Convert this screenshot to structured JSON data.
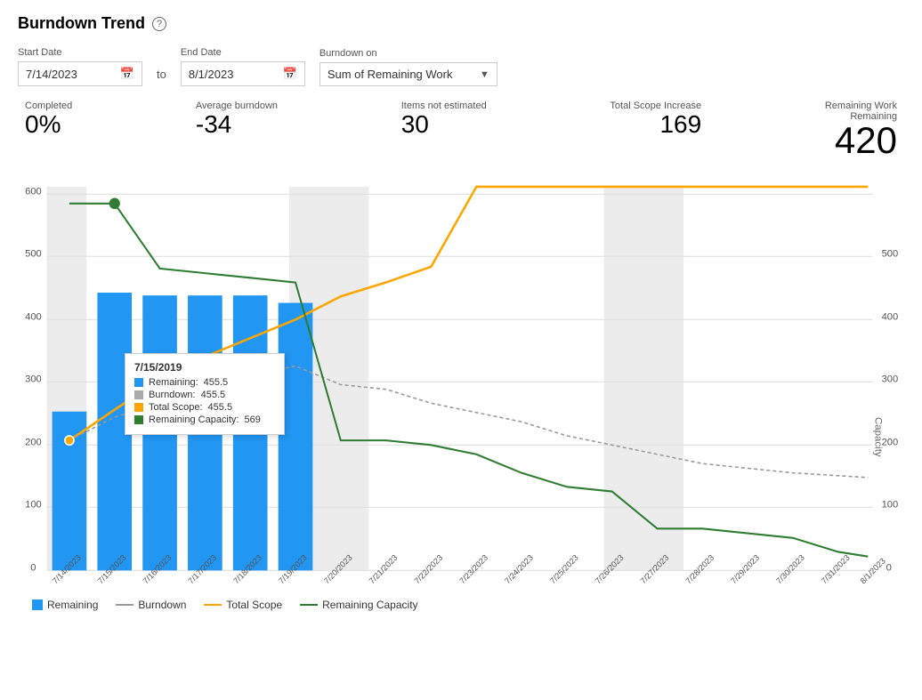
{
  "title": "Burndown Trend",
  "help_icon": "?",
  "controls": {
    "start_date_label": "Start Date",
    "start_date_value": "7/14/2023",
    "to_label": "to",
    "end_date_label": "End Date",
    "end_date_value": "8/1/2023",
    "burndown_label": "Burndown on",
    "burndown_value": "Sum of Remaining Work"
  },
  "stats": {
    "completed_label": "Completed",
    "completed_value": "0%",
    "avg_burndown_label": "Average burndown",
    "avg_burndown_value": "-34",
    "items_not_estimated_label": "Items not estimated",
    "items_not_estimated_value": "30",
    "total_scope_label": "Total Scope Increase",
    "total_scope_value": "169",
    "remaining_work_label": "Remaining Work",
    "remaining_label": "Remaining",
    "remaining_value": "420"
  },
  "tooltip": {
    "date": "7/15/2019",
    "remaining_label": "Remaining:",
    "remaining_value": "455.5",
    "burndown_label": "Burndown:",
    "burndown_value": "455.5",
    "total_scope_label": "Total Scope:",
    "total_scope_value": "455.5",
    "remaining_capacity_label": "Remaining Capacity:",
    "remaining_capacity_value": "569"
  },
  "legend": [
    {
      "type": "box",
      "color": "#2196F3",
      "label": "Remaining"
    },
    {
      "type": "line",
      "color": "#888",
      "label": "Burndown"
    },
    {
      "type": "line",
      "color": "#FFA500",
      "label": "Total Scope"
    },
    {
      "type": "line",
      "color": "#2E7D32",
      "label": "Remaining Capacity"
    }
  ],
  "y_axis_left": [
    "600",
    "500",
    "400",
    "300",
    "200",
    "100",
    "0"
  ],
  "y_axis_right": [
    "500",
    "400",
    "300",
    "200",
    "100",
    "0"
  ],
  "x_axis": [
    "7/14/2023",
    "7/15/2023",
    "7/16/2023",
    "7/17/2023",
    "7/18/2023",
    "7/19/2023",
    "7/20/2023",
    "7/21/2023",
    "7/22/2023",
    "7/23/2023",
    "7/24/2023",
    "7/25/2023",
    "7/26/2023",
    "7/27/2023",
    "7/28/2023",
    "7/29/2023",
    "7/30/2023",
    "7/31/2023",
    "8/1/2023"
  ],
  "colors": {
    "bar": "#2196F3",
    "burndown_line": "#888888",
    "total_scope_line": "#FFA500",
    "remaining_capacity_line": "#2E7D32",
    "weekend_bg": "#e8e8e8",
    "accent": "#0078d4"
  }
}
